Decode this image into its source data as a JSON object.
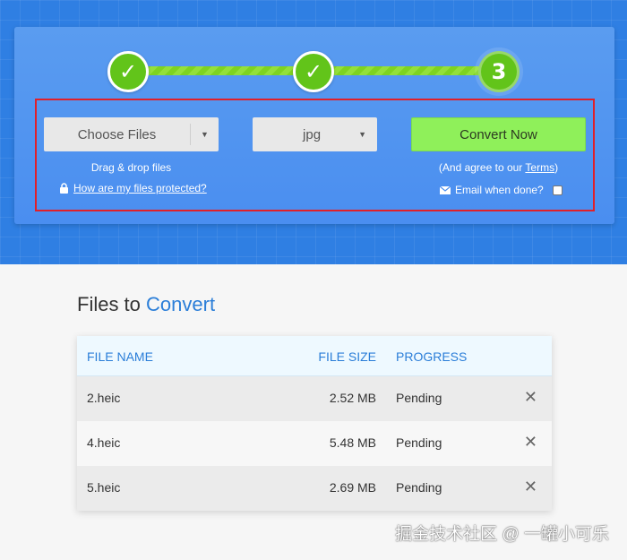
{
  "steps": [
    {
      "label": "✓",
      "state": "done",
      "icon": "checkmark-icon"
    },
    {
      "label": "✓",
      "state": "done",
      "icon": "checkmark-icon"
    },
    {
      "label": "3",
      "state": "current"
    }
  ],
  "uploader": {
    "choose_files_label": "Choose Files",
    "choose_caret": "▼",
    "drag_drop_text": "Drag & drop files",
    "protected_link": "How are my files protected?",
    "format_value": "jpg",
    "format_caret": "▼",
    "convert_label": "Convert Now",
    "agree_prefix": "(And agree to our ",
    "terms_link": "Terms",
    "agree_suffix": ")",
    "email_label": "Email when done?",
    "email_checked": false
  },
  "files_section": {
    "title_plain": "Files to ",
    "title_accent": "Convert",
    "columns": [
      "FILE NAME",
      "FILE SIZE",
      "PROGRESS"
    ],
    "rows": [
      {
        "name": "2.heic",
        "size": "2.52 MB",
        "progress": "Pending",
        "remove": "✕"
      },
      {
        "name": "4.heic",
        "size": "5.48 MB",
        "progress": "Pending",
        "remove": "✕"
      },
      {
        "name": "5.heic",
        "size": "2.69 MB",
        "progress": "Pending",
        "remove": "✕"
      }
    ]
  },
  "watermark": "掘金技术社区 @ 一罐小可乐",
  "colors": {
    "band_blue": "#2f7fe3",
    "panel_blue": "#4a8ef0",
    "step_green": "#62c41a",
    "convert_green": "#8ff05a",
    "accent_blue": "#2b7ed8",
    "highlight_red": "#e0202a"
  }
}
